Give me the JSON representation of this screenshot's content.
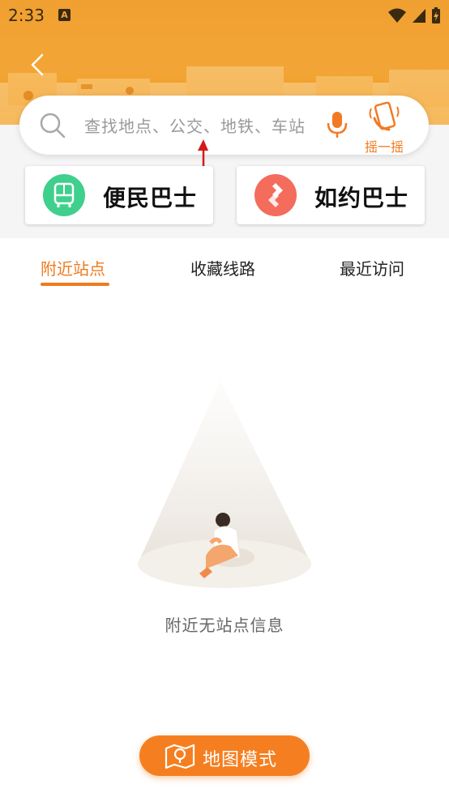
{
  "status_bar": {
    "time": "2:33",
    "notification_icon": "A"
  },
  "search": {
    "placeholder": "查找地点、公交、地铁、车站",
    "shake_label": "摇一摇"
  },
  "cards": [
    {
      "label": "便民巴士",
      "color": "#3fd08d"
    },
    {
      "label": "如约巴士",
      "color": "#f46c5c"
    }
  ],
  "tabs": [
    {
      "label": "附近站点",
      "active": true
    },
    {
      "label": "收藏线路",
      "active": false
    },
    {
      "label": "最近访问",
      "active": false
    }
  ],
  "empty_state": {
    "message": "附近无站点信息"
  },
  "map_button": {
    "label": "地图模式"
  },
  "colors": {
    "accent": "#f57f20",
    "banner": "#f2a536"
  }
}
